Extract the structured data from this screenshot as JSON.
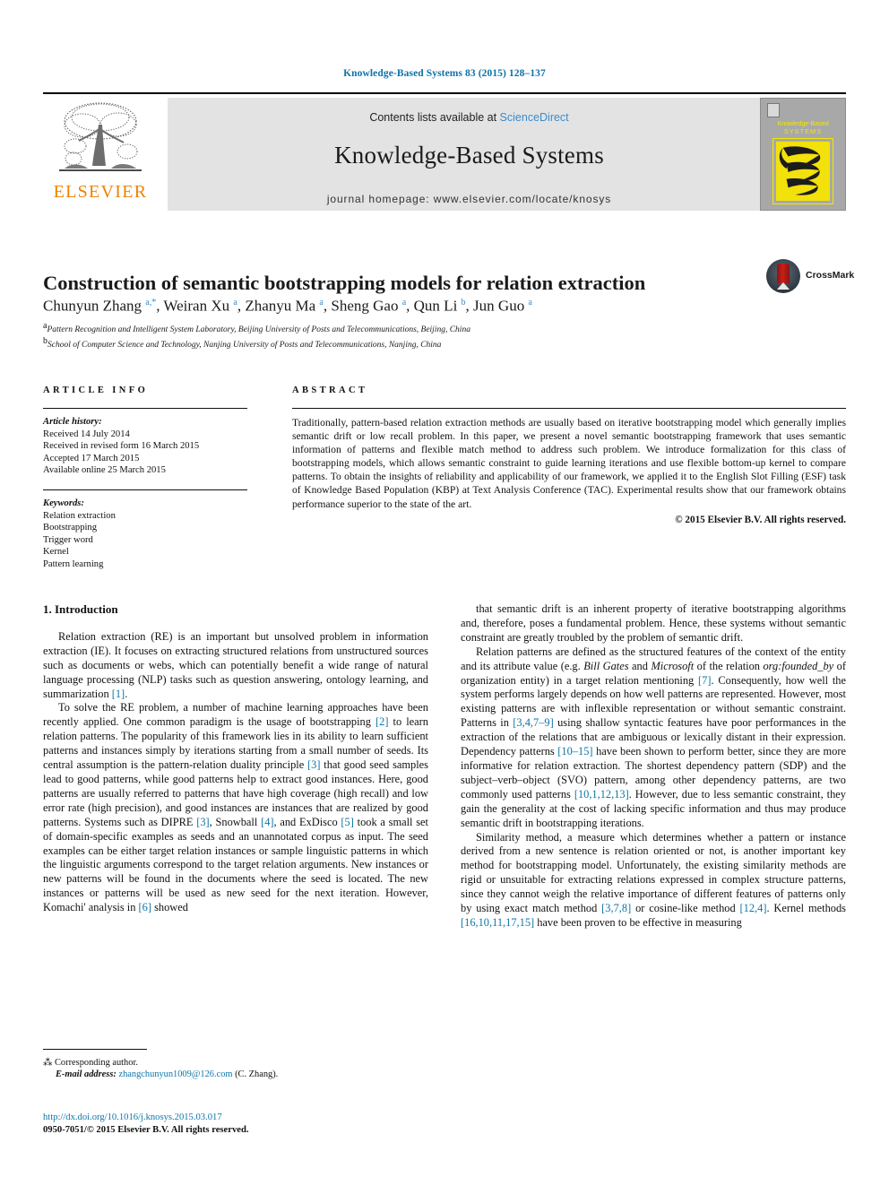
{
  "running_head": "Knowledge-Based Systems 83 (2015) 128–137",
  "masthead": {
    "publisher_name": "ELSEVIER",
    "contents_prefix": "Contents lists available at ",
    "contents_link": "ScienceDirect",
    "journal_name": "Knowledge-Based Systems",
    "homepage": "journal homepage: www.elsevier.com/locate/knosys",
    "cover": {
      "line1": "Knowledge-Based",
      "line2": "SYSTEMS"
    }
  },
  "article": {
    "title": "Construction of semantic bootstrapping models for relation extraction",
    "crossmark_label": "CrossMark",
    "authors_html": "Chunyun Zhang <sup>a,*</sup>, Weiran Xu <sup>a</sup>, Zhanyu Ma <sup>a</sup>, Sheng Gao <sup>a</sup>, Qun Li <sup>b</sup>, Jun Guo <sup>a</sup>",
    "affiliation_a": "Pattern Recognition and Intelligent System Laboratory, Beijing University of Posts and Telecommunications, Beijing, China",
    "affiliation_b": "School of Computer Science and Technology, Nanjing University of Posts and Telecommunications, Nanjing, China"
  },
  "article_info": {
    "heading": "ARTICLE INFO",
    "history_label": "Article history:",
    "history": [
      "Received 14 July 2014",
      "Received in revised form 16 March 2015",
      "Accepted 17 March 2015",
      "Available online 25 March 2015"
    ],
    "keywords_label": "Keywords:",
    "keywords": [
      "Relation extraction",
      "Bootstrapping",
      "Trigger word",
      "Kernel",
      "Pattern learning"
    ]
  },
  "abstract": {
    "heading": "ABSTRACT",
    "text": "Traditionally, pattern-based relation extraction methods are usually based on iterative bootstrapping model which generally implies semantic drift or low recall problem. In this paper, we present a novel semantic bootstrapping framework that uses semantic information of patterns and flexible match method to address such problem. We introduce formalization for this class of bootstrapping models, which allows semantic constraint to guide learning iterations and use flexible bottom-up kernel to compare patterns. To obtain the insights of reliability and applicability of our framework, we applied it to the English Slot Filling (ESF) task of Knowledge Based Population (KBP) at Text Analysis Conference (TAC). Experimental results show that our framework obtains performance superior to the state of the art.",
    "copyright": "© 2015 Elsevier B.V. All rights reserved."
  },
  "body": {
    "section_heading": "1. Introduction",
    "left_paragraph_1_html": "Relation extraction (RE) is an important but unsolved problem in information extraction (IE). It focuses on extracting structured relations from unstructured sources such as documents or webs, which can potentially benefit a wide range of natural language processing (NLP) tasks such as question answering, ontology learning, and summarization <span class=\"ref\">[1]</span>.",
    "left_paragraph_2_html": "To solve the RE problem, a number of machine learning approaches have been recently applied. One common paradigm is the usage of bootstrapping <span class=\"ref\">[2]</span> to learn relation patterns. The popularity of this framework lies in its ability to learn sufficient patterns and instances simply by iterations starting from a small number of seeds. Its central assumption is the pattern-relation duality principle <span class=\"ref\">[3]</span> that good seed samples lead to good patterns, while good patterns help to extract good instances. Here, good patterns are usually referred to patterns that have high coverage (high recall) and low error rate (high precision), and good instances are instances that are realized by good patterns. Systems such as DIPRE <span class=\"ref\">[3]</span>, Snowball <span class=\"ref\">[4]</span>, and ExDisco <span class=\"ref\">[5]</span> took a small set of domain-specific examples as seeds and an unannotated corpus as input. The seed examples can be either target relation instances or sample linguistic patterns in which the linguistic arguments correspond to the target relation arguments. New instances or new patterns will be found in the documents where the seed is located. The new instances or patterns will be used as new seed for the next iteration. However, Komachi' analysis in <span class=\"ref\">[6]</span> showed",
    "right_paragraph_1_html": "that semantic drift is an inherent property of iterative bootstrapping algorithms and, therefore, poses a fundamental problem. Hence, these systems without semantic constraint are greatly troubled by the problem of semantic drift.",
    "right_paragraph_2_html": "Relation patterns are defined as the structured features of the context of the entity and its attribute value (e.g. <span class=\"it\">Bill Gates</span> and <span class=\"it\">Microsoft</span> of the relation <span class=\"it\">org:founded_by</span> of organization entity) in a target relation mentioning <span class=\"ref\">[7]</span>. Consequently, how well the system performs largely depends on how well patterns are represented. However, most existing patterns are with inflexible representation or without semantic constraint. Patterns in <span class=\"ref\">[3,4,7–9]</span> using shallow syntactic features have poor performances in the extraction of the relations that are ambiguous or lexically distant in their expression. Dependency patterns <span class=\"ref\">[10–15]</span> have been shown to perform better, since they are more informative for relation extraction. The shortest dependency pattern (SDP) and the subject–verb–object (SVO) pattern, among other dependency patterns, are two commonly used patterns <span class=\"ref\">[10,1,12,13]</span>. However, due to less semantic constraint, they gain the generality at the cost of lacking specific information and thus may produce semantic drift in bootstrapping iterations.",
    "right_paragraph_3_html": "Similarity method, a measure which determines whether a pattern or instance derived from a new sentence is relation oriented or not, is another important key method for bootstrapping model. Unfortunately, the existing similarity methods are rigid or unsuitable for extracting relations expressed in complex structure patterns, since they cannot weigh the relative importance of different features of patterns only by using exact match method <span class=\"ref\">[3,7,8]</span> or cosine-like method <span class=\"ref\">[12,4]</span>. Kernel methods <span class=\"ref\">[16,10,11,17,15]</span> have been proven to be effective in measuring"
  },
  "footnotes": {
    "corresponding_author": "Corresponding author.",
    "email_label": "E-mail address:",
    "email": "zhangchunyun1009@126.com",
    "email_owner": "(C. Zhang).",
    "doi": "http://dx.doi.org/10.1016/j.knosys.2015.03.017",
    "issn_line": "0950-7051/© 2015 Elsevier B.V. All rights reserved."
  },
  "colors": {
    "link": "#0e76a8",
    "header": "#0c72a8",
    "sciencedirect": "#3a8ccc",
    "elsevier_orange": "#ef8200",
    "cover_yellow": "#f2e10a"
  }
}
